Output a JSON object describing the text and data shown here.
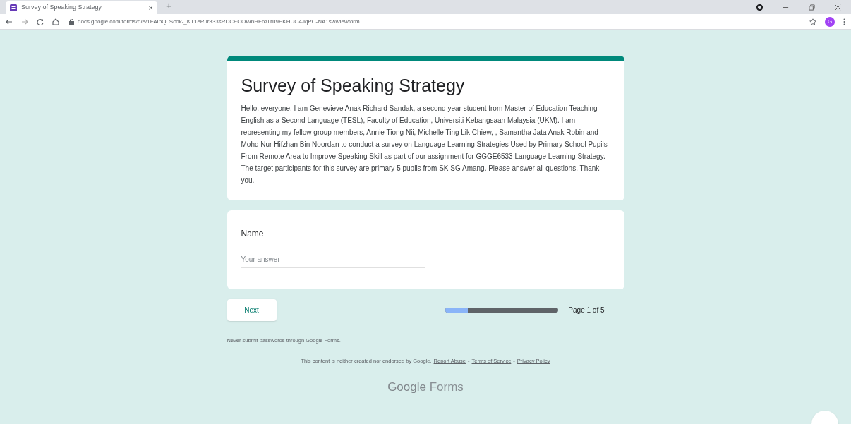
{
  "browser": {
    "tab": {
      "title": "Survey of Speaking Strategy",
      "close": "×"
    },
    "new_tab": "+",
    "url": "docs.google.com/forms/d/e/1FAIpQLScok-_KT1eRJr333sRDCECOWnHF6zutu9EKHUO4JqPC-NA1sw/viewform",
    "profile_initial": "G"
  },
  "form": {
    "title": "Survey of Speaking Strategy",
    "description": "Hello, everyone. I am Genevieve Anak Richard Sandak, a second year student from Master of Education Teaching English as a Second Language (TESL), Faculty of Education, Universiti Kebangsaan Malaysia (UKM). I am representing my fellow group members, Annie Tiong Nii, Michelle Ting Lik Chiew, , Samantha Jata Anak Robin and Mohd Nur Hifzhan Bin Noordan to conduct a survey on Language Learning Strategies Used by Primary School Pupils From Remote Area to Improve Speaking Skill as part of our assignment for GGGE6533 Language Learning Strategy. The target participants for this survey are primary 5 pupils from SK SG Amang. Please answer all questions. Thank you.",
    "questions": [
      {
        "label": "Name",
        "placeholder": "Your answer"
      }
    ],
    "next_button": "Next",
    "progress": {
      "level": 0.2,
      "label": "Page 1 of 5"
    }
  },
  "footer": {
    "warning": "Never submit passwords through Google Forms.",
    "disclaimer": "This content is neither created nor endorsed by Google.",
    "links": [
      "Report Abuse",
      "Terms of Service",
      "Privacy Policy"
    ],
    "separator": "-",
    "brand": "Google",
    "product": "Forms"
  }
}
